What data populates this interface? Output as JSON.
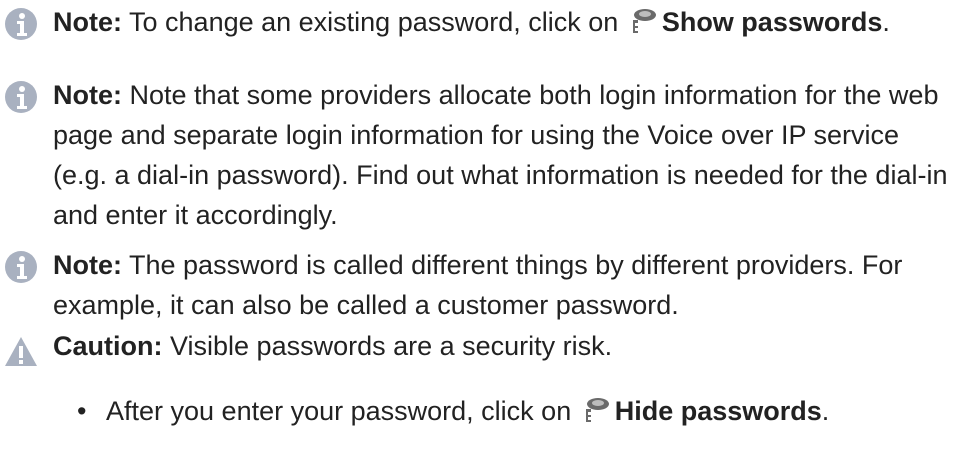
{
  "colors": {
    "info_icon": "#a9b1c0",
    "caution_icon": "#a9b1c0",
    "text": "#222222"
  },
  "notes": [
    {
      "icon": "info-icon",
      "label": "Note:",
      "text_before": "To change an existing password, click on",
      "button_icon": "key-icon",
      "button": "Show passwords",
      "text_after": "."
    },
    {
      "icon": "info-icon",
      "label": "Note:",
      "text": "Note that some providers allocate both login information for the web page and separate login information for using the Voice over IP service (e.g. a dial-in password). Find out what information is needed for the dial-in and enter it accordingly."
    },
    {
      "icon": "info-icon",
      "label": "Note:",
      "text": "The password is called different things by different providers. For example, it can also be called a customer password."
    }
  ],
  "caution": {
    "icon": "warning-triangle-icon",
    "label": "Caution:",
    "text": "Visible passwords are a security risk."
  },
  "caution_list": [
    {
      "bullet": "•",
      "text_before": "After you enter your password, click on",
      "button_icon": "key-icon",
      "button": "Hide passwords",
      "text_after": "."
    }
  ]
}
